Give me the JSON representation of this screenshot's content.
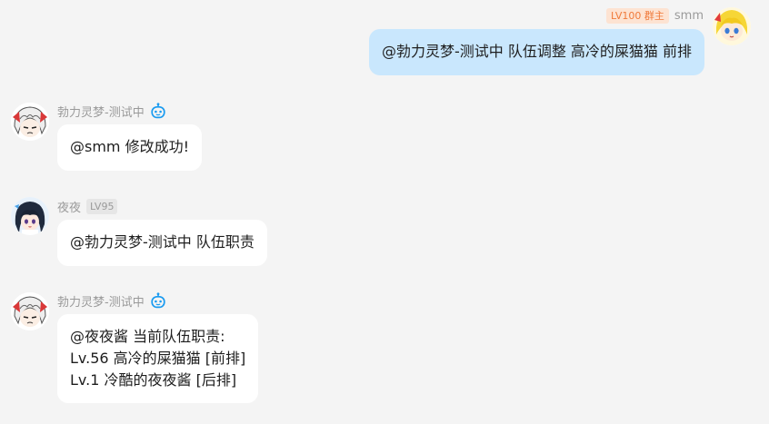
{
  "messages": [
    {
      "sender": "smm",
      "level_badge": "LV100",
      "role_badge": "群主",
      "text": "@勃力灵梦-测试中 队伍调整 高冷的屎猫猫 前排"
    },
    {
      "sender": "勃力灵梦-测试中",
      "text": "@smm 修改成功!"
    },
    {
      "sender": "夜夜",
      "level_badge": "LV95",
      "text": "@勃力灵梦-测试中 队伍职责"
    },
    {
      "sender": "勃力灵梦-测试中",
      "lines": [
        "@夜夜酱 当前队伍职责:",
        "Lv.56 高冷的屎猫猫 [前排]",
        "Lv.1 冷酷的夜夜酱 [后排]"
      ]
    }
  ],
  "icons": {
    "bot": "robot-icon",
    "owner_avatar": "yellow-haired-anime-avatar",
    "bot_avatar": "white-haired-anime-avatar",
    "yeye_avatar": "dark-haired-anime-avatar"
  },
  "colors": {
    "background": "#f4f4f4",
    "own_bubble": "#c9e7fd",
    "other_bubble": "#ffffff",
    "owner_badge_text": "#f07a3a",
    "owner_badge_bg": "#fde3d2",
    "bot_icon": "#1a9bf0"
  }
}
